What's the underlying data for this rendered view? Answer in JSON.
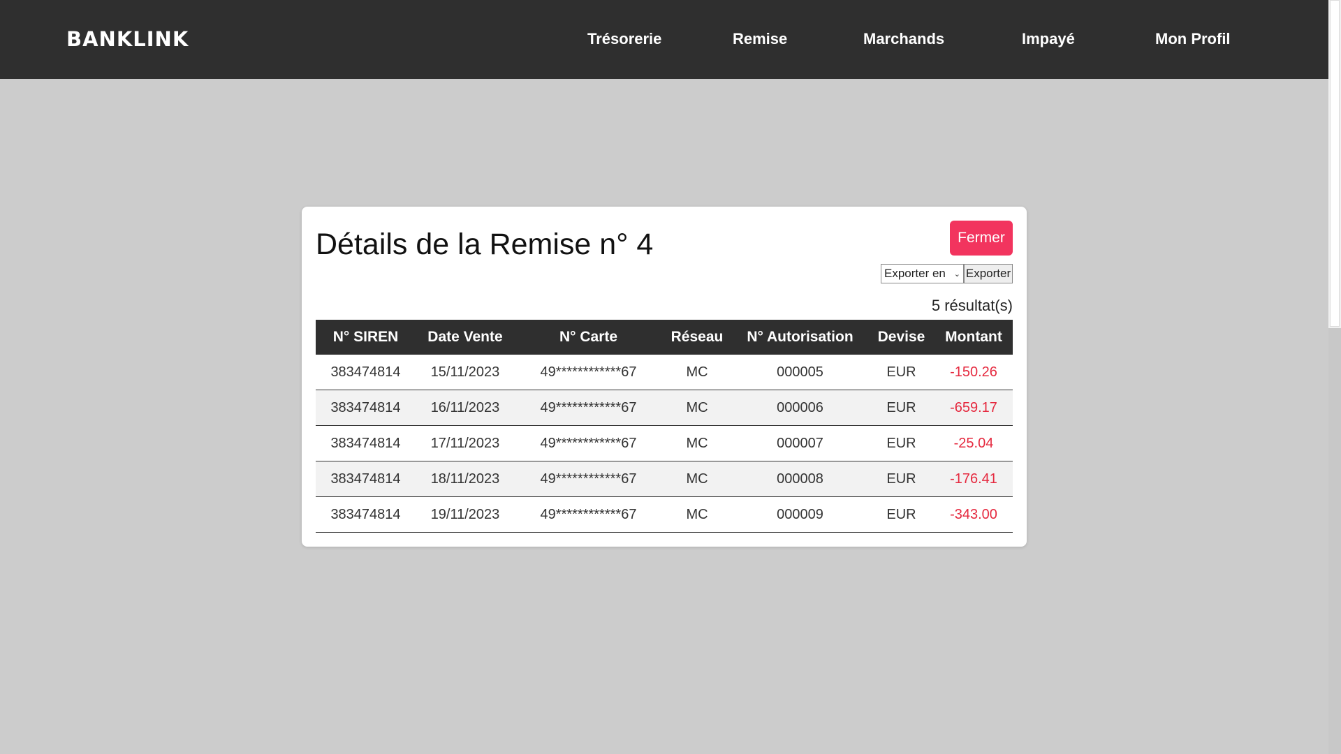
{
  "app": {
    "logo": "BANKLINK"
  },
  "nav": {
    "tresorerie": "Trésorerie",
    "remise": "Remise",
    "marchands": "Marchands",
    "impaye": "Impayé",
    "profil": "Mon Profil"
  },
  "modal": {
    "title": "Détails de la Remise n° 4",
    "close_label": "Fermer",
    "export_select_value": "Exporter en",
    "export_button_label": "Exporter",
    "result_count": "5 résultat(s)"
  },
  "table": {
    "headers": [
      "N° SIREN",
      "Date Vente",
      "N° Carte",
      "Réseau",
      "N° Autorisation",
      "Devise",
      "Montant"
    ],
    "rows": [
      [
        "383474814",
        "15/11/2023",
        "49************67",
        "MC",
        "000005",
        "EUR",
        "-150.26"
      ],
      [
        "383474814",
        "16/11/2023",
        "49************67",
        "MC",
        "000006",
        "EUR",
        "-659.17"
      ],
      [
        "383474814",
        "17/11/2023",
        "49************67",
        "MC",
        "000007",
        "EUR",
        "-25.04"
      ],
      [
        "383474814",
        "18/11/2023",
        "49************67",
        "MC",
        "000008",
        "EUR",
        "-176.41"
      ],
      [
        "383474814",
        "19/11/2023",
        "49************67",
        "MC",
        "000009",
        "EUR",
        "-343.00"
      ]
    ]
  },
  "colors": {
    "topbar": "#2f2f2f",
    "background": "#cccccc",
    "accent": "#f2345e",
    "negative_amount": "#e5283e"
  }
}
